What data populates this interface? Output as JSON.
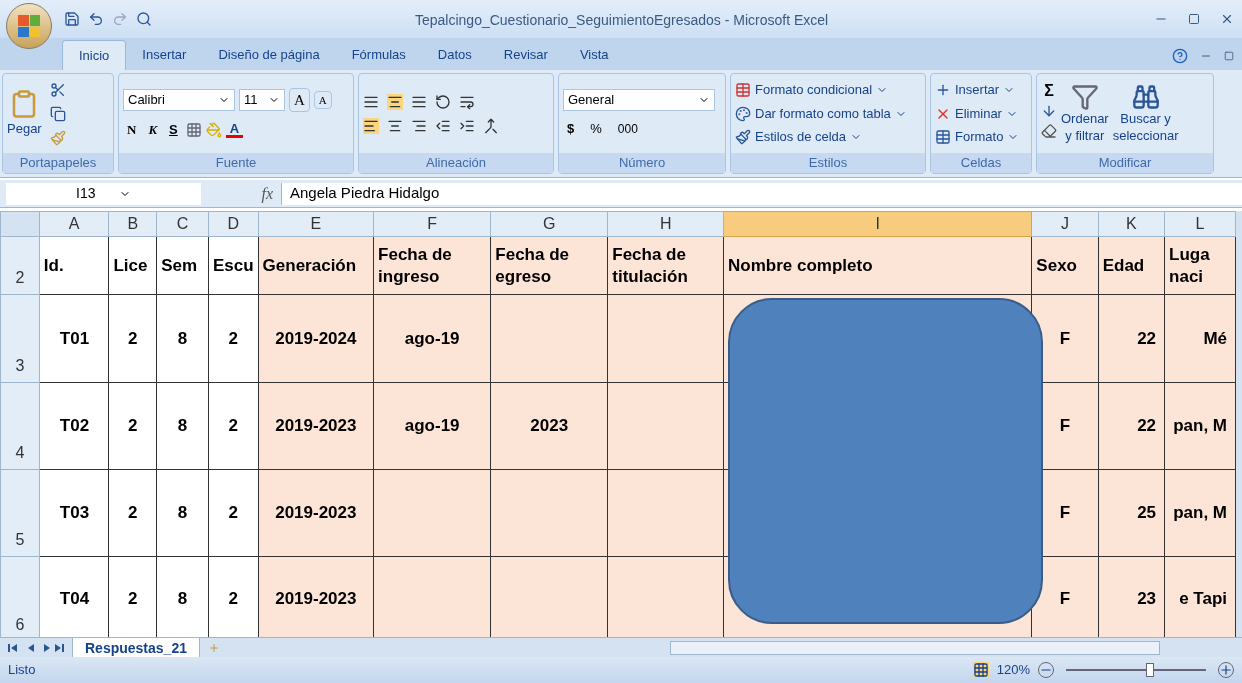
{
  "window": {
    "title": "Tepalcingo_Cuestionario_SeguimientoEgresados - Microsoft Excel"
  },
  "ribbon_tabs": [
    {
      "label": "Inicio",
      "selected": true
    },
    {
      "label": "Insertar",
      "selected": false
    },
    {
      "label": "Diseño de página",
      "selected": false
    },
    {
      "label": "Fórmulas",
      "selected": false
    },
    {
      "label": "Datos",
      "selected": false
    },
    {
      "label": "Revisar",
      "selected": false
    },
    {
      "label": "Vista",
      "selected": false
    }
  ],
  "clipboard": {
    "label": "Portapapeles",
    "paste": "Pegar"
  },
  "font": {
    "label": "Fuente",
    "family": "Calibri",
    "size": "11",
    "grow": "A",
    "shrink": "A",
    "bold": "N",
    "italic": "K",
    "underline": "S",
    "color_letter": "A"
  },
  "alignment": {
    "label": "Alineación"
  },
  "number": {
    "label": "Número",
    "format": "General",
    "currency": "$",
    "percent": "%",
    "thousands": "000"
  },
  "styles": {
    "label": "Estilos",
    "items": [
      "Formato condicional",
      "Dar formato como tabla",
      "Estilos de celda"
    ]
  },
  "cells_group": {
    "label": "Celdas",
    "items": [
      "Insertar",
      "Eliminar",
      "Formato"
    ]
  },
  "editing": {
    "label": "Modificar",
    "sum": "Σ",
    "sort": [
      "Ordenar",
      "y filtrar"
    ],
    "find": [
      "Buscar y",
      "seleccionar"
    ]
  },
  "formula_bar": {
    "name_box": "I13",
    "function_label": "fx",
    "value": "Angela Piedra Hidalgo"
  },
  "columns": [
    {
      "label": "A",
      "selected": false
    },
    {
      "label": "B",
      "selected": false
    },
    {
      "label": "C",
      "selected": false
    },
    {
      "label": "D",
      "selected": false
    },
    {
      "label": "E",
      "selected": false
    },
    {
      "label": "F",
      "selected": false
    },
    {
      "label": "G",
      "selected": false
    },
    {
      "label": "H",
      "selected": false
    },
    {
      "label": "I",
      "selected": true
    },
    {
      "label": "J",
      "selected": false
    },
    {
      "label": "K",
      "selected": false
    },
    {
      "label": "L",
      "selected": false
    }
  ],
  "rows": [
    {
      "number": "2",
      "cells": [
        "Id.",
        "Lice",
        "Sem",
        "Escu",
        "Generación",
        "Fecha de ingreso",
        "Fecha de egreso",
        "Fecha de titulación",
        "Nombre completo",
        "Sexo",
        "Edad",
        "Luga naci"
      ]
    },
    {
      "number": "3",
      "cells": [
        "T01",
        "2",
        "8",
        "2",
        "2019-2024",
        "ago-19",
        "",
        "",
        "",
        "F",
        "22",
        "Mé"
      ]
    },
    {
      "number": "4",
      "cells": [
        "T02",
        "2",
        "8",
        "2",
        "2019-2023",
        "ago-19",
        "2023",
        "",
        "",
        "F",
        "22",
        "pan, M"
      ]
    },
    {
      "number": "5",
      "cells": [
        "T03",
        "2",
        "8",
        "2",
        "2019-2023",
        "",
        "",
        "",
        "",
        "F",
        "25",
        "pan, M"
      ]
    },
    {
      "number": "6",
      "cells": [
        "T04",
        "2",
        "8",
        "2",
        "2019-2023",
        "",
        "",
        "",
        "",
        "F",
        "23",
        "e Tapi"
      ]
    }
  ],
  "sheet_tabs": [
    {
      "label": "Respuestas_21",
      "selected": true
    }
  ],
  "status_bar": {
    "status": "Listo",
    "zoom": "120%",
    "level": 0.6
  }
}
